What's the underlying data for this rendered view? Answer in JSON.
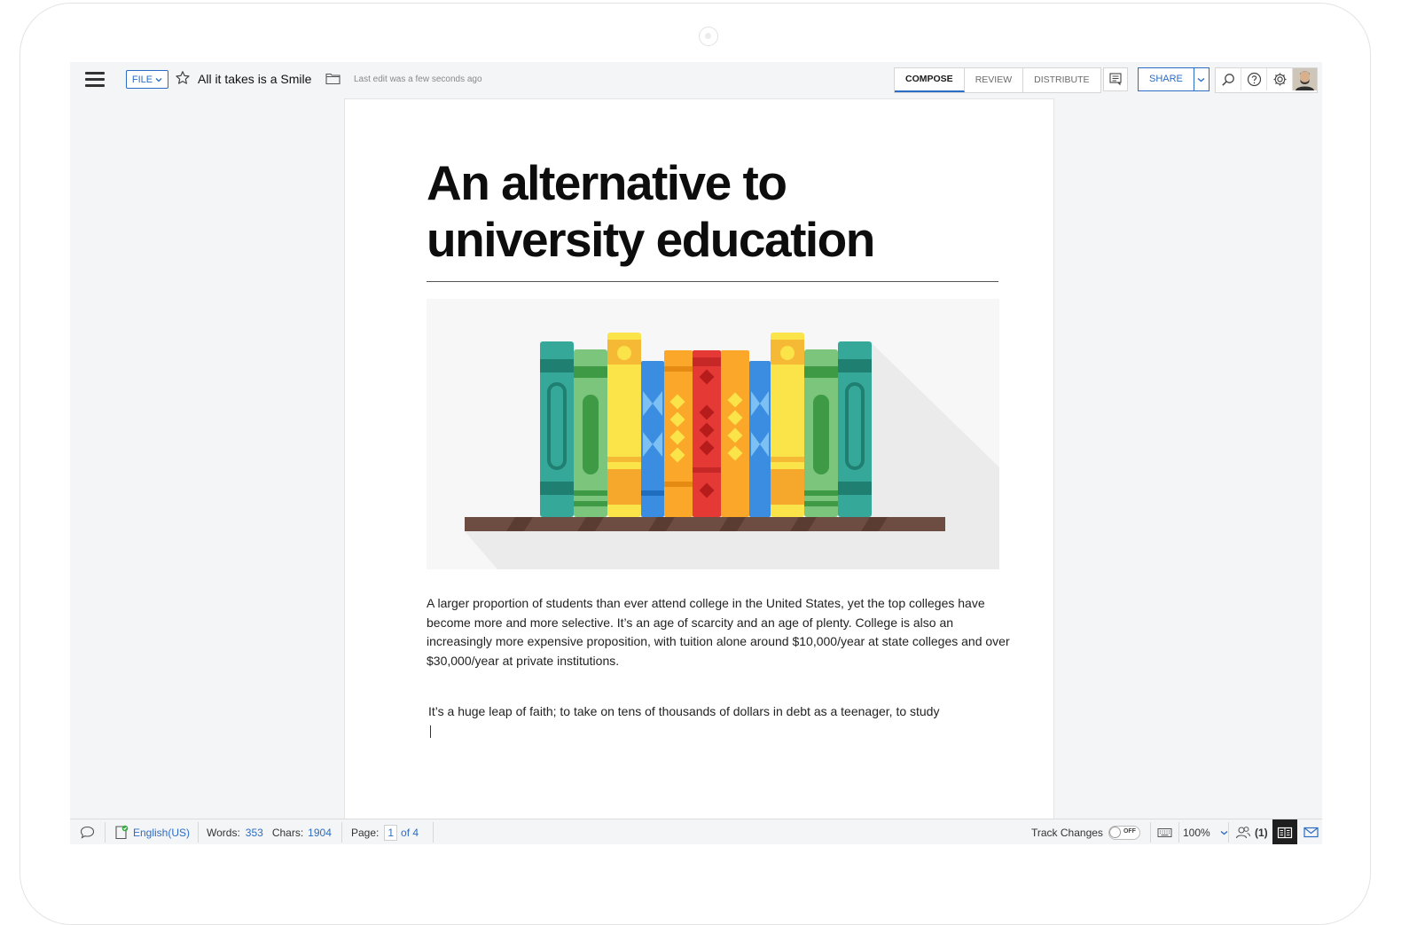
{
  "topbar": {
    "file_label": "FILE",
    "doc_title": "All it takes is a Smile",
    "last_edit": "Last edit was a few seconds ago",
    "tabs": [
      "COMPOSE",
      "REVIEW",
      "DISTRIBUTE"
    ],
    "active_tab": "COMPOSE",
    "share_label": "SHARE",
    "icons": [
      "hamburger-menu-icon",
      "star-icon",
      "folder-icon",
      "comment-pane-icon",
      "search-icon",
      "help-icon",
      "gear-icon",
      "user-avatar"
    ]
  },
  "document": {
    "heading": "An alternative to university education",
    "paragraph_1": "A larger proportion of students than ever attend college in the United States, yet the top colleges have become more and more selective. It’s an age of scarcity and an age of plenty. College is also an increasingly more expensive proposition, with tuition alone around $10,000/year at state colleges and over $30,000/year at private institutions.",
    "paragraph_2": "It’s a huge leap of faith; to take on tens of thousands of dollars in debt as a teenager, to study",
    "illustration": "books-on-shelf-illustration"
  },
  "statusbar": {
    "language": "English(US)",
    "words_label": "Words:",
    "words_value": "353",
    "chars_label": "Chars:",
    "chars_value": "1904",
    "page_label": "Page:",
    "page_current": "1",
    "page_total": "of 4",
    "track_changes_label": "Track Changes",
    "track_changes_state": "OFF",
    "zoom": "100%",
    "collaborators": "(1)"
  },
  "colors": {
    "accent": "#2b6cc4",
    "canvas_bg": "#f4f5f6",
    "page_bg": "#ffffff",
    "heading": "#0d0d0d"
  }
}
